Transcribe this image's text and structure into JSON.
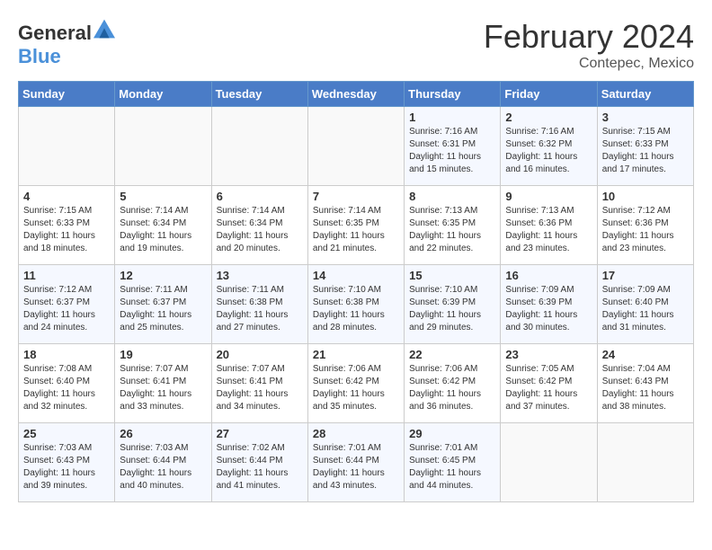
{
  "header": {
    "logo_general": "General",
    "logo_blue": "Blue",
    "month_year": "February 2024",
    "location": "Contepec, Mexico"
  },
  "weekdays": [
    "Sunday",
    "Monday",
    "Tuesday",
    "Wednesday",
    "Thursday",
    "Friday",
    "Saturday"
  ],
  "weeks": [
    [
      {
        "day": "",
        "info": ""
      },
      {
        "day": "",
        "info": ""
      },
      {
        "day": "",
        "info": ""
      },
      {
        "day": "",
        "info": ""
      },
      {
        "day": "1",
        "info": "Sunrise: 7:16 AM\nSunset: 6:31 PM\nDaylight: 11 hours and 15 minutes."
      },
      {
        "day": "2",
        "info": "Sunrise: 7:16 AM\nSunset: 6:32 PM\nDaylight: 11 hours and 16 minutes."
      },
      {
        "day": "3",
        "info": "Sunrise: 7:15 AM\nSunset: 6:33 PM\nDaylight: 11 hours and 17 minutes."
      }
    ],
    [
      {
        "day": "4",
        "info": "Sunrise: 7:15 AM\nSunset: 6:33 PM\nDaylight: 11 hours and 18 minutes."
      },
      {
        "day": "5",
        "info": "Sunrise: 7:14 AM\nSunset: 6:34 PM\nDaylight: 11 hours and 19 minutes."
      },
      {
        "day": "6",
        "info": "Sunrise: 7:14 AM\nSunset: 6:34 PM\nDaylight: 11 hours and 20 minutes."
      },
      {
        "day": "7",
        "info": "Sunrise: 7:14 AM\nSunset: 6:35 PM\nDaylight: 11 hours and 21 minutes."
      },
      {
        "day": "8",
        "info": "Sunrise: 7:13 AM\nSunset: 6:35 PM\nDaylight: 11 hours and 22 minutes."
      },
      {
        "day": "9",
        "info": "Sunrise: 7:13 AM\nSunset: 6:36 PM\nDaylight: 11 hours and 23 minutes."
      },
      {
        "day": "10",
        "info": "Sunrise: 7:12 AM\nSunset: 6:36 PM\nDaylight: 11 hours and 23 minutes."
      }
    ],
    [
      {
        "day": "11",
        "info": "Sunrise: 7:12 AM\nSunset: 6:37 PM\nDaylight: 11 hours and 24 minutes."
      },
      {
        "day": "12",
        "info": "Sunrise: 7:11 AM\nSunset: 6:37 PM\nDaylight: 11 hours and 25 minutes."
      },
      {
        "day": "13",
        "info": "Sunrise: 7:11 AM\nSunset: 6:38 PM\nDaylight: 11 hours and 27 minutes."
      },
      {
        "day": "14",
        "info": "Sunrise: 7:10 AM\nSunset: 6:38 PM\nDaylight: 11 hours and 28 minutes."
      },
      {
        "day": "15",
        "info": "Sunrise: 7:10 AM\nSunset: 6:39 PM\nDaylight: 11 hours and 29 minutes."
      },
      {
        "day": "16",
        "info": "Sunrise: 7:09 AM\nSunset: 6:39 PM\nDaylight: 11 hours and 30 minutes."
      },
      {
        "day": "17",
        "info": "Sunrise: 7:09 AM\nSunset: 6:40 PM\nDaylight: 11 hours and 31 minutes."
      }
    ],
    [
      {
        "day": "18",
        "info": "Sunrise: 7:08 AM\nSunset: 6:40 PM\nDaylight: 11 hours and 32 minutes."
      },
      {
        "day": "19",
        "info": "Sunrise: 7:07 AM\nSunset: 6:41 PM\nDaylight: 11 hours and 33 minutes."
      },
      {
        "day": "20",
        "info": "Sunrise: 7:07 AM\nSunset: 6:41 PM\nDaylight: 11 hours and 34 minutes."
      },
      {
        "day": "21",
        "info": "Sunrise: 7:06 AM\nSunset: 6:42 PM\nDaylight: 11 hours and 35 minutes."
      },
      {
        "day": "22",
        "info": "Sunrise: 7:06 AM\nSunset: 6:42 PM\nDaylight: 11 hours and 36 minutes."
      },
      {
        "day": "23",
        "info": "Sunrise: 7:05 AM\nSunset: 6:42 PM\nDaylight: 11 hours and 37 minutes."
      },
      {
        "day": "24",
        "info": "Sunrise: 7:04 AM\nSunset: 6:43 PM\nDaylight: 11 hours and 38 minutes."
      }
    ],
    [
      {
        "day": "25",
        "info": "Sunrise: 7:03 AM\nSunset: 6:43 PM\nDaylight: 11 hours and 39 minutes."
      },
      {
        "day": "26",
        "info": "Sunrise: 7:03 AM\nSunset: 6:44 PM\nDaylight: 11 hours and 40 minutes."
      },
      {
        "day": "27",
        "info": "Sunrise: 7:02 AM\nSunset: 6:44 PM\nDaylight: 11 hours and 41 minutes."
      },
      {
        "day": "28",
        "info": "Sunrise: 7:01 AM\nSunset: 6:44 PM\nDaylight: 11 hours and 43 minutes."
      },
      {
        "day": "29",
        "info": "Sunrise: 7:01 AM\nSunset: 6:45 PM\nDaylight: 11 hours and 44 minutes."
      },
      {
        "day": "",
        "info": ""
      },
      {
        "day": "",
        "info": ""
      }
    ]
  ]
}
